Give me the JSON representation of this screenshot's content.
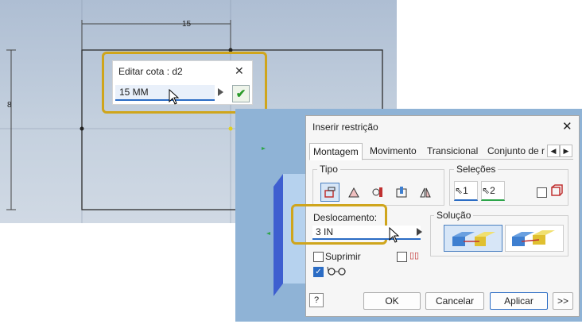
{
  "sketch": {
    "dim_horizontal": "15",
    "dim_vertical": "8"
  },
  "edit_dim": {
    "title": "Editar cota : d2",
    "value": "15 MM"
  },
  "constraint": {
    "title": "Inserir restrição",
    "tabs": [
      "Montagem",
      "Movimento",
      "Transicional",
      "Conjunto de r"
    ],
    "type_label": "Tipo",
    "selections_label": "Seleções",
    "sel1": "1",
    "sel2": "2",
    "offset_label": "Deslocamento:",
    "offset_value": "3 IN",
    "solution_label": "Solução",
    "suppress_label": "Suprimir",
    "ok": "OK",
    "cancel": "Cancelar",
    "apply": "Aplicar",
    "more": ">>"
  },
  "colors": {
    "accent": "#2b6cc4",
    "highlight": "#cfa51c",
    "ok_green": "#2a9a2a"
  }
}
